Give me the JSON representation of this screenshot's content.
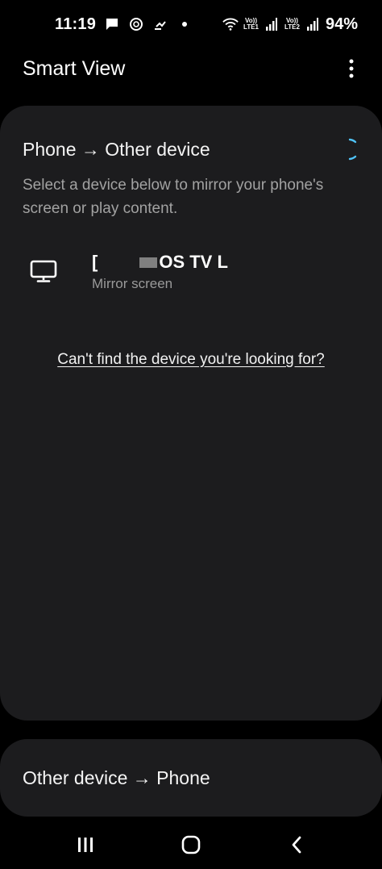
{
  "status_bar": {
    "time": "11:19",
    "sim1_label_top": "Vo))",
    "sim1_label_bottom": "LTE1",
    "sim2_label_top": "Vo))",
    "sim2_label_bottom": "LTE2",
    "battery": "94%",
    "icons": [
      "message-icon",
      "sync-icon",
      "transfer-icon",
      "dot-icon",
      "wifi-icon",
      "signal-icon",
      "signal-icon"
    ]
  },
  "app_bar": {
    "title": "Smart View",
    "menu_icon": "more-vertical-icon"
  },
  "main_card": {
    "title": "Phone → Other device",
    "description": "Select a device below to mirror your phone's screen or play content.",
    "devices": [
      {
        "name_start": "[",
        "name_end": "OS TV L",
        "subtitle": "Mirror screen",
        "icon": "tv-icon"
      }
    ],
    "help_link": "Can't find the device you're looking for?"
  },
  "second_card": {
    "title": "Other device → Phone"
  },
  "nav_bar": {
    "buttons": [
      "recents-icon",
      "home-icon",
      "back-icon"
    ]
  },
  "colors": {
    "background": "#000000",
    "card": "#1c1c1e",
    "secondary_text": "#a2a2a2",
    "spinner_accent": "#4fc3f7"
  }
}
